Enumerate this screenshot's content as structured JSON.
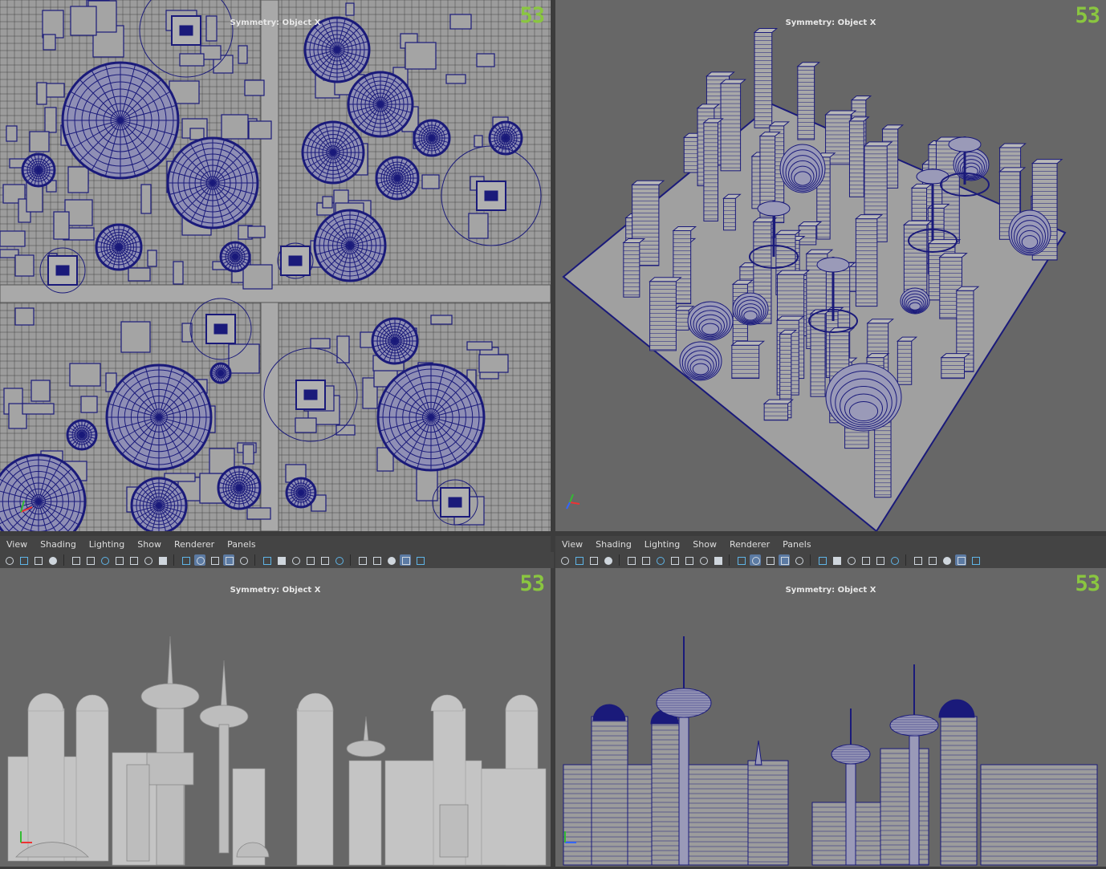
{
  "viewports": [
    {
      "id": "top",
      "symmetry": "Symmetry: Object X",
      "logo": "53"
    },
    {
      "id": "persp",
      "symmetry": "Symmetry: Object X",
      "logo": "53"
    },
    {
      "id": "front",
      "symmetry": "Symmetry: Object X",
      "logo": "53"
    },
    {
      "id": "side",
      "symmetry": "Symmetry: Object X",
      "logo": "53"
    }
  ],
  "panel_menu": [
    "View",
    "Shading",
    "Lighting",
    "Show",
    "Renderer",
    "Panels"
  ],
  "colors": {
    "wire": "#1a1a7a",
    "mesh": "#9c9c9c",
    "viewport_bg": "#676767",
    "logo": "#8ac640",
    "toolbar": "#444444",
    "active_icon": "#5b7aa3"
  },
  "toolbar_icons": [
    "camera-icon",
    "camera-attr-icon",
    "bookmark-icon",
    "image-plane-icon",
    "grid-icon",
    "film-gate-icon",
    "resolution-gate-icon",
    "gate-mask-icon",
    "field-chart-icon",
    "safe-action-icon",
    "safe-title-icon",
    "wireframe-icon",
    "smooth-shade-icon",
    "default-lighting-icon",
    "wireframe-on-shaded-icon",
    "textured-icon",
    "use-all-lights-icon",
    "shadows-icon",
    "ambient-occlusion-icon",
    "motion-blur-icon",
    "anti-alias-icon",
    "depth-of-field-icon",
    "isolate-select-icon",
    "xray-icon",
    "xray-joints-icon",
    "xray-active-icon",
    "resolution-icon"
  ]
}
